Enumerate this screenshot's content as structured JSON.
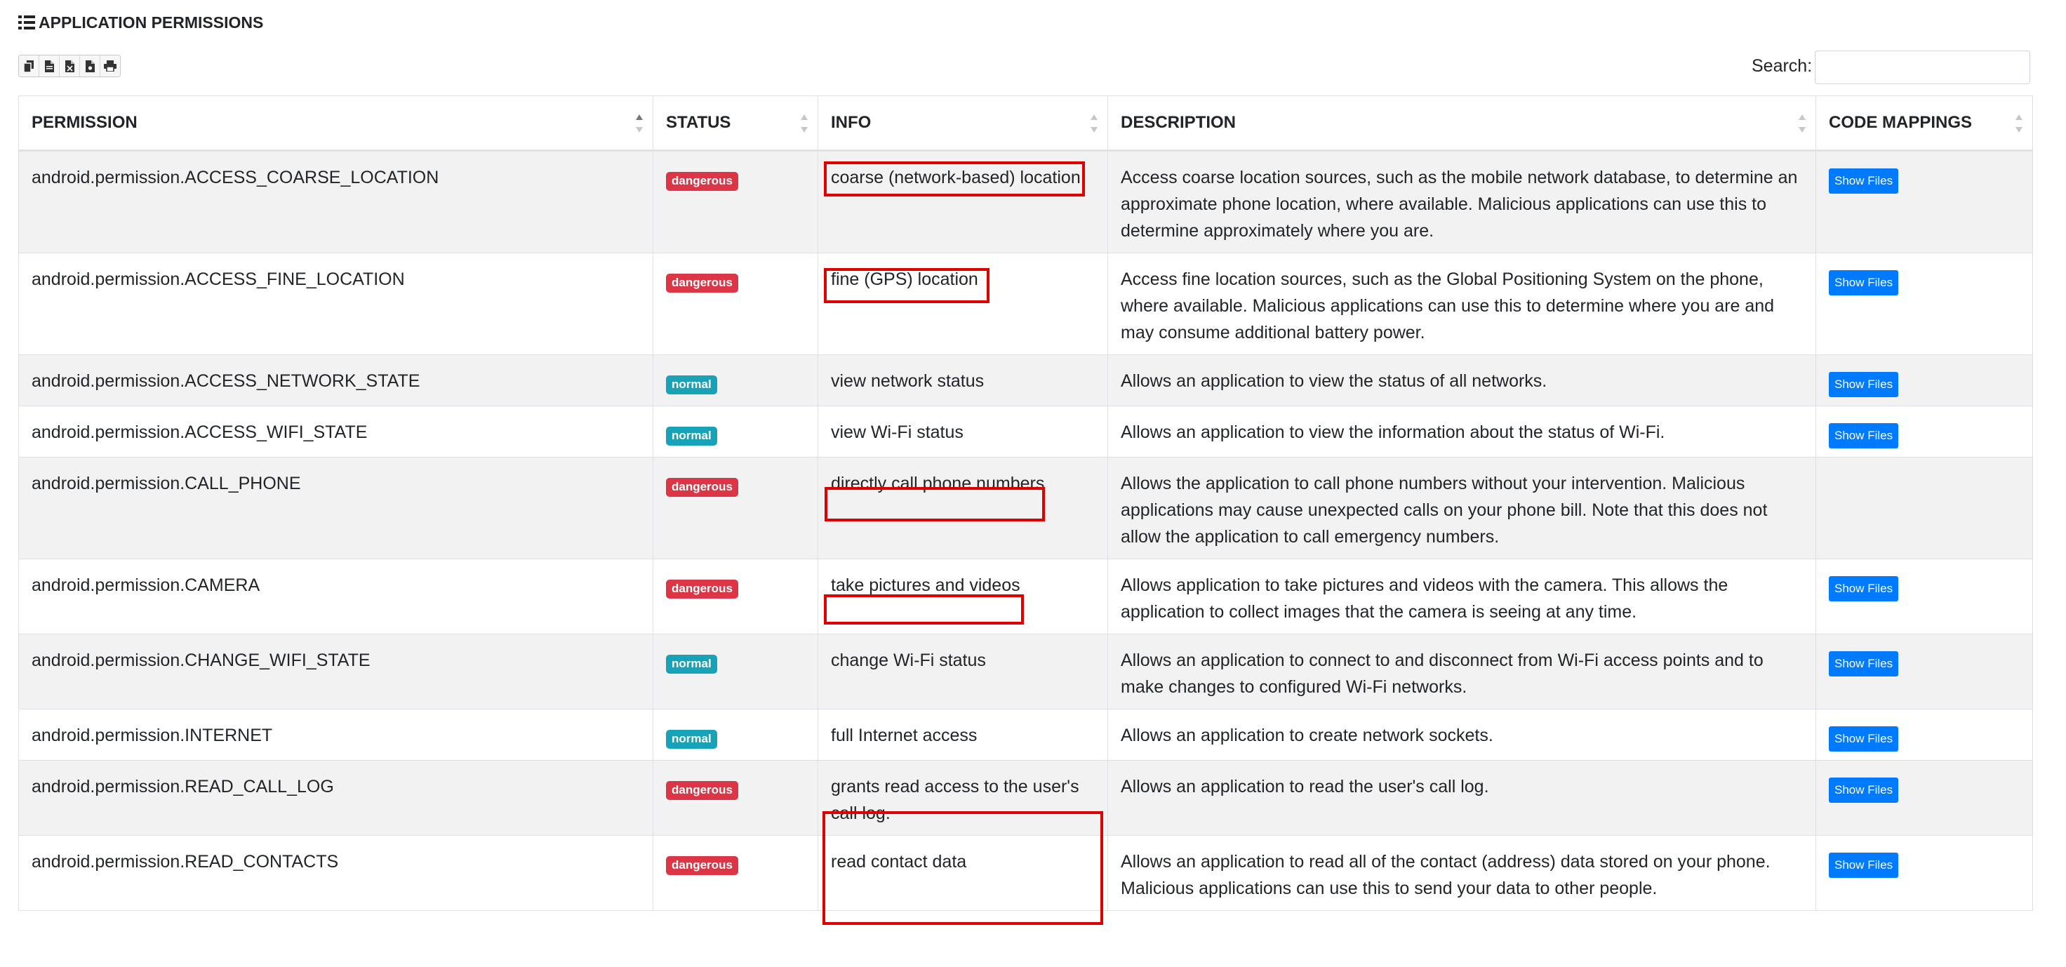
{
  "card": {
    "title": "APPLICATION PERMISSIONS",
    "title_icon": "list-icon"
  },
  "toolbar": {
    "buttons": [
      "copy-icon",
      "csv-icon",
      "excel-icon",
      "pdf-icon",
      "print-icon"
    ]
  },
  "search": {
    "label": "Search:",
    "value": "",
    "placeholder": ""
  },
  "table": {
    "columns": [
      "PERMISSION",
      "STATUS",
      "INFO",
      "DESCRIPTION",
      "CODE MAPPINGS"
    ],
    "sorted_column": "PERMISSION",
    "sort_direction": "ascending",
    "rows": [
      {
        "permission": "android.permission.ACCESS_COARSE_LOCATION",
        "status": "dangerous",
        "info": "coarse (network-based) location",
        "description": "Access coarse location sources, such as the mobile network database, to determine an approximate phone location, where available. Malicious applications can use this to determine approximately where you are.",
        "code_mappings": "Show Files"
      },
      {
        "permission": "android.permission.ACCESS_FINE_LOCATION",
        "status": "dangerous",
        "info": "fine (GPS) location",
        "description": "Access fine location sources, such as the Global Positioning System on the phone, where available. Malicious applications can use this to determine where you are and may consume additional battery power.",
        "code_mappings": "Show Files"
      },
      {
        "permission": "android.permission.ACCESS_NETWORK_STATE",
        "status": "normal",
        "info": "view network status",
        "description": "Allows an application to view the status of all networks.",
        "code_mappings": "Show Files"
      },
      {
        "permission": "android.permission.ACCESS_WIFI_STATE",
        "status": "normal",
        "info": "view Wi-Fi status",
        "description": "Allows an application to view the information about the status of Wi-Fi.",
        "code_mappings": "Show Files"
      },
      {
        "permission": "android.permission.CALL_PHONE",
        "status": "dangerous",
        "info": "directly call phone numbers",
        "description": "Allows the application to call phone numbers without your intervention. Malicious applications may cause unexpected calls on your phone bill. Note that this does not allow the application to call emergency numbers.",
        "code_mappings": ""
      },
      {
        "permission": "android.permission.CAMERA",
        "status": "dangerous",
        "info": "take pictures and videos",
        "description": "Allows application to take pictures and videos with the camera. This allows the application to collect images that the camera is seeing at any time.",
        "code_mappings": "Show Files"
      },
      {
        "permission": "android.permission.CHANGE_WIFI_STATE",
        "status": "normal",
        "info": "change Wi-Fi status",
        "description": "Allows an application to connect to and disconnect from Wi-Fi access points and to make changes to configured Wi-Fi networks.",
        "code_mappings": "Show Files"
      },
      {
        "permission": "android.permission.INTERNET",
        "status": "normal",
        "info": "full Internet access",
        "description": "Allows an application to create network sockets.",
        "code_mappings": "Show Files"
      },
      {
        "permission": "android.permission.READ_CALL_LOG",
        "status": "dangerous",
        "info": "grants read access to the user's call log.",
        "description": "Allows an application to read the user's call log.",
        "code_mappings": "Show Files"
      },
      {
        "permission": "android.permission.READ_CONTACTS",
        "status": "dangerous",
        "info": "read contact data",
        "description": "Allows an application to read all of the contact (address) data stored on your phone. Malicious applications can use this to send your data to other people.",
        "code_mappings": "Show Files"
      }
    ]
  },
  "colors": {
    "dangerous": "#dc3545",
    "normal": "#17a2b8",
    "button": "#007bff",
    "highlight": "#e00000",
    "stripe": "#f2f2f2"
  }
}
